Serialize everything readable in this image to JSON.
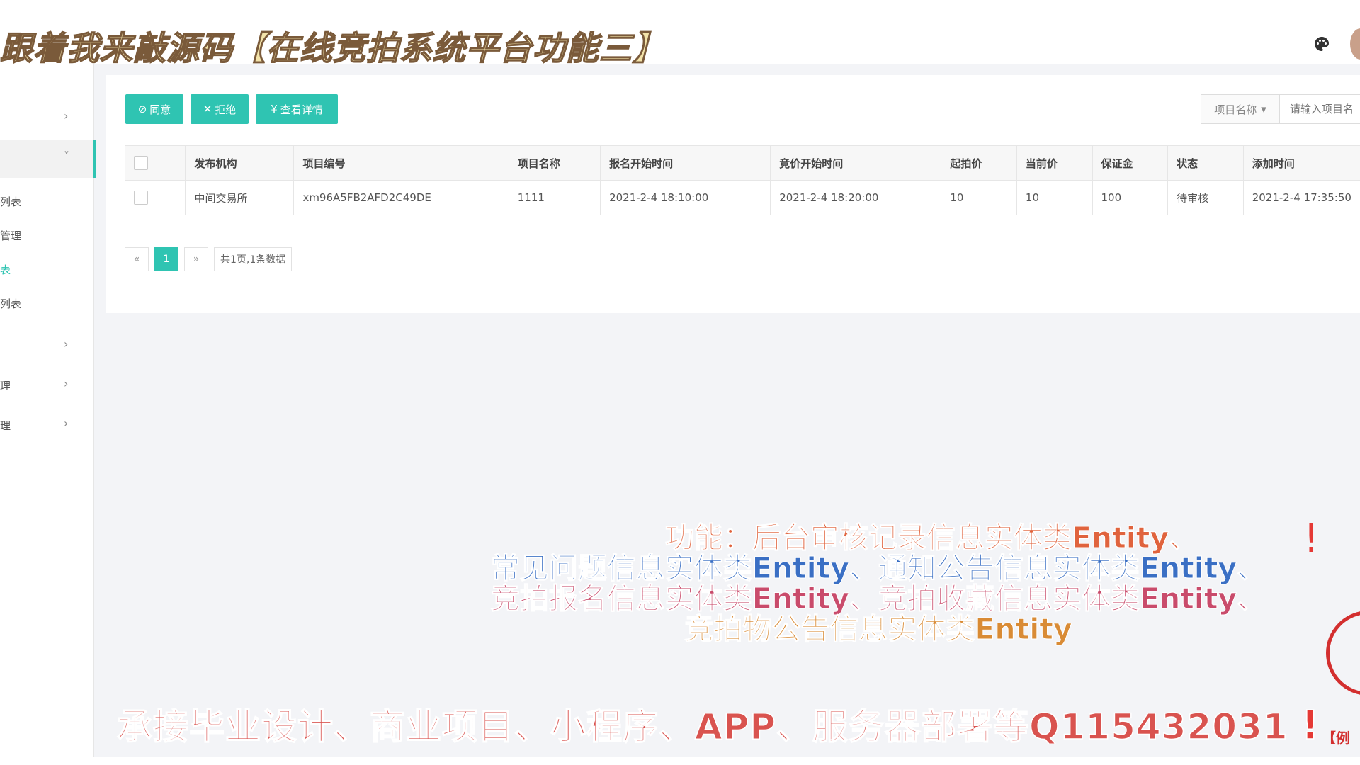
{
  "header": {
    "overlay_title": "跟着我来敲源码【在线竞拍系统平台功能三】",
    "palette_icon": "palette-icon",
    "avatar_icon": "avatar"
  },
  "sidebar": {
    "items": [
      {
        "label": "",
        "chevron": "›"
      },
      {
        "label": "",
        "chevron": "˅"
      },
      {
        "label": "列表",
        "chevron": ""
      },
      {
        "label": "管理",
        "chevron": ""
      },
      {
        "label": "表",
        "chevron": ""
      },
      {
        "label": "列表",
        "chevron": ""
      },
      {
        "label": "",
        "chevron": "›"
      },
      {
        "label": "理",
        "chevron": "›"
      },
      {
        "label": "理",
        "chevron": "›"
      }
    ]
  },
  "toolbar": {
    "agree_label": "同意",
    "reject_label": "拒绝",
    "details_label": "查看详情",
    "search_field_label": "项目名称",
    "search_placeholder": "请输入项目名"
  },
  "table": {
    "headers": [
      "",
      "发布机构",
      "项目编号",
      "项目名称",
      "报名开始时间",
      "竞价开始时间",
      "起拍价",
      "当前价",
      "保证金",
      "状态",
      "添加时间"
    ],
    "rows": [
      [
        "",
        "中间交易所",
        "xm96A5FB2AFD2C49DE",
        "1111",
        "2021-2-4 18:10:00",
        "2021-2-4 18:20:00",
        "10",
        "10",
        "100",
        "待审核",
        "2021-2-4 17:35:50"
      ]
    ]
  },
  "pagination": {
    "prev": "«",
    "current": "1",
    "next": "»",
    "summary": "共1页,1条数据"
  },
  "overlay": {
    "features": [
      "功能：后台审核记录信息实体类Entity、",
      "常见问题信息实体类Entity、通知公告信息实体类Entity、",
      "竞拍报名信息实体类Entity、竞拍收藏信息实体类Entity、",
      "竞拍物公告信息实体类Entity"
    ],
    "contact": "承接毕业设计、商业项目、小程序、APP、服务器部署等Q115432031",
    "exclaim": "!",
    "seal_text": "【例"
  },
  "colors": {
    "accent": "#2fc4b2",
    "status_pending": "#1a9e4b"
  }
}
